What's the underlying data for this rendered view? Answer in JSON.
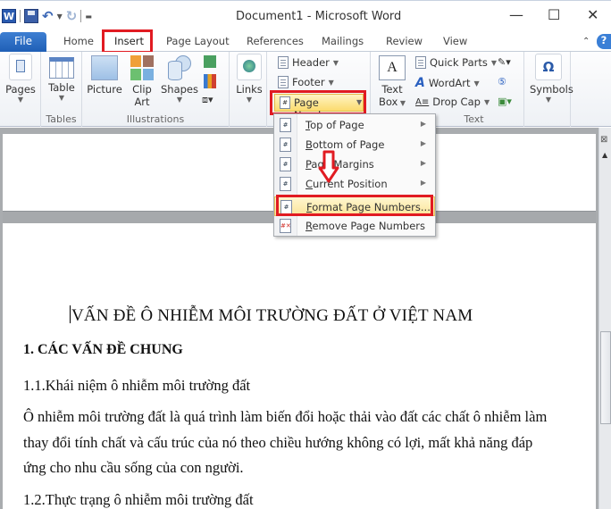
{
  "titlebar": {
    "document_title": "Document1 - Microsoft Word",
    "app_icon": "word-icon",
    "qat": [
      "save-icon",
      "undo-icon",
      "undo-dropdown",
      "redo-icon",
      "customize-qat-icon"
    ],
    "controls": {
      "minimize": "—",
      "maximize": "☐",
      "close": "✕"
    }
  },
  "tabs": [
    {
      "label": "File"
    },
    {
      "label": "Home"
    },
    {
      "label": "Insert",
      "active": true,
      "highlighted": true
    },
    {
      "label": "Page Layout"
    },
    {
      "label": "References"
    },
    {
      "label": "Mailings"
    },
    {
      "label": "Review"
    },
    {
      "label": "View"
    }
  ],
  "ribbon": {
    "pages": {
      "label": "Pages"
    },
    "tables": {
      "button": "Table",
      "group": "Tables"
    },
    "illustrations": {
      "picture": "Picture",
      "clipart_1": "Clip",
      "clipart_2": "Art",
      "shapes": "Shapes",
      "group": "Illustrations"
    },
    "links": {
      "label": "Links"
    },
    "header_footer": {
      "header": "Header",
      "footer": "Footer",
      "page_number": "Page Number"
    },
    "text": {
      "textbox_1": "Text",
      "textbox_2": "Box",
      "quick_parts": "Quick Parts",
      "wordart": "WordArt",
      "drop_cap": "Drop Cap",
      "group": "Text"
    },
    "symbols": {
      "label": "Symbols",
      "glyph": "Ω"
    }
  },
  "page_number_menu": {
    "items": [
      {
        "label": "Top of Page",
        "accel": "T",
        "rest": "op of Page",
        "submenu": true
      },
      {
        "label": "Bottom of Page",
        "accel": "B",
        "rest": "ottom of Page",
        "submenu": true
      },
      {
        "label": "Page Margins",
        "accel": "P",
        "rest": "age Margins",
        "submenu": true
      },
      {
        "label": "Current Position",
        "accel": "C",
        "rest": "urrent Position",
        "submenu": true
      },
      {
        "label": "Format Page Numbers...",
        "accel": "F",
        "rest": "ormat Page Numbers...",
        "highlighted": true
      },
      {
        "label": "Remove Page Numbers",
        "accel": "R",
        "rest": "emove Page Numbers"
      }
    ]
  },
  "document": {
    "title": "VẤN ĐỀ Ô NHIỄM  MÔI TRƯỜNG ĐẤT Ở VIỆT NAM",
    "heading1": "1. CÁC VẤN ĐỀ CHUNG",
    "sub1": "1.1.Khái niệm ô nhiễm môi trường đất",
    "para_line1": "Ô nhiễm môi trường đất là quá trình làm biến đổi hoặc thải vào đất các chất ô nhiễm làm",
    "para_line2": "thay đổi tính chất và cấu trúc của nó theo chiều hướng không có lợi, mất khả năng đáp",
    "para_line3": "ứng cho nhu cầu sống của con người.",
    "sub2": "1.2.Thực trạng ô nhiễm môi trường đất"
  },
  "colors": {
    "highlight_red": "#e11b22",
    "file_tab": "#2b6cc4",
    "menu_highlight": "#fbe59a"
  }
}
